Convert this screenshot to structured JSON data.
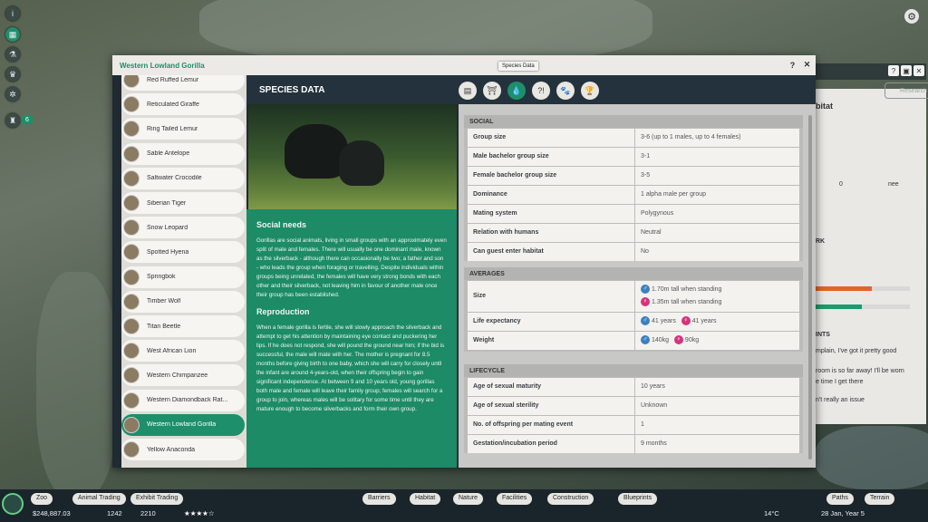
{
  "window": {
    "title": "Western Lowland Gorilla",
    "help": "?",
    "close": "✕"
  },
  "tooltip": "Species Data",
  "header": {
    "title": "SPECIES DATA",
    "research": "Research"
  },
  "tabs": [
    {
      "name": "info-icon",
      "glyph": "▤"
    },
    {
      "name": "habitat-icon",
      "glyph": "⛩"
    },
    {
      "name": "water-drop-icon",
      "glyph": "💧"
    },
    {
      "name": "enrichment-icon",
      "glyph": "?!"
    },
    {
      "name": "paw-icon",
      "glyph": "🐾"
    },
    {
      "name": "trophy-icon",
      "glyph": "🏆"
    }
  ],
  "species_list": [
    "Red Ruffed Lemur",
    "Reticulated Giraffe",
    "Ring Tailed Lemur",
    "Sable Antelope",
    "Saltwater Crocodile",
    "Siberian Tiger",
    "Snow Leopard",
    "Spotted Hyena",
    "Springbok",
    "Timber Wolf",
    "Titan Beetle",
    "West African Lion",
    "Western Chimpanzee",
    "Western Diamondback Rat...",
    "Western Lowland Gorilla",
    "Yellow Anaconda"
  ],
  "selected_index": 14,
  "text": {
    "social_heading": "Social needs",
    "social_body": "Gorillas are social animals, living in small groups with an approximately even split of male and females. There will usually be one dominant male, known as the silverback - although there can occasionally be two; a father and son - who leads the group when foraging or travelling. Despite individuals within groups being unrelated, the females will have very strong bonds with each other and their silverback, not leaving him in favour of another male once their group has been established.",
    "repro_heading": "Reproduction",
    "repro_body": "When a female gorilla is fertile, she will slowly approach the silverback and attempt to get his attention by maintaining eye contact and puckering her lips. If he does not respond, she will pound the ground near him; if the bid is successful, the male will mate with her. The mother is pregnant for 8.5 months before giving birth to one baby, which she will carry for closely until the infant are around 4-years-old, when their offspring begin to gain significant independence. At between 9 and 10 years old, young gorillas both male and female will leave their family group; females will search for a group to join, whereas males will be solitary for some time until they are mature enough to become silverbacks and form their own group."
  },
  "social": {
    "title": "SOCIAL",
    "rows": [
      {
        "k": "Group size",
        "v": "3-6 (up to 1 males, up to 4 females)"
      },
      {
        "k": "Male bachelor group size",
        "v": "3-1"
      },
      {
        "k": "Female bachelor group size",
        "v": "3-5"
      },
      {
        "k": "Dominance",
        "v": "1 alpha male per group"
      },
      {
        "k": "Mating system",
        "v": "Polygynous"
      },
      {
        "k": "Relation with humans",
        "v": "Neutral"
      },
      {
        "k": "Can guest enter habitat",
        "v": "No"
      }
    ]
  },
  "averages": {
    "title": "AVERAGES",
    "size_label": "Size",
    "size_male": "1.70m tall when standing",
    "size_female": "1.35m tall when standing",
    "life_label": "Life expectancy",
    "life_male": "41 years",
    "life_female": "41 years",
    "weight_label": "Weight",
    "weight_male": "140kg",
    "weight_female": "90kg",
    "male_symbol": "♂",
    "female_symbol": "♀"
  },
  "lifecycle": {
    "title": "LIFECYCLE",
    "rows": [
      {
        "k": "Age of sexual maturity",
        "v": "10 years"
      },
      {
        "k": "Age of sexual sterility",
        "v": "Unknown"
      },
      {
        "k": "No. of offspring per mating event",
        "v": "1"
      },
      {
        "k": "Gestation/incubation period",
        "v": "9 months"
      }
    ]
  },
  "right_panel": {
    "title_fragment": "bitat",
    "count": "0",
    "rating_word": "nee",
    "work_fragment": "RK",
    "guests_fragment": "INTS",
    "c1": "mplain, I've got it pretty good",
    "c2": "room is so far away! I'll be worn",
    "c3": "e time I get there",
    "c4": "n't really an issue"
  },
  "bottom": {
    "buttons_left": [
      "Zoo",
      "Animal Trading",
      "Exhibit Trading"
    ],
    "buttons_mid": [
      "Barriers",
      "Habitat",
      "Nature",
      "Facilities",
      "Construction",
      "Blueprints"
    ],
    "buttons_right": [
      "Paths",
      "Terrain"
    ],
    "money": "$248,887.03",
    "guests": "1242",
    "animals": "2210",
    "temp": "14°C",
    "date": "28 Jan, Year 5"
  },
  "side": {
    "badge": "6"
  }
}
